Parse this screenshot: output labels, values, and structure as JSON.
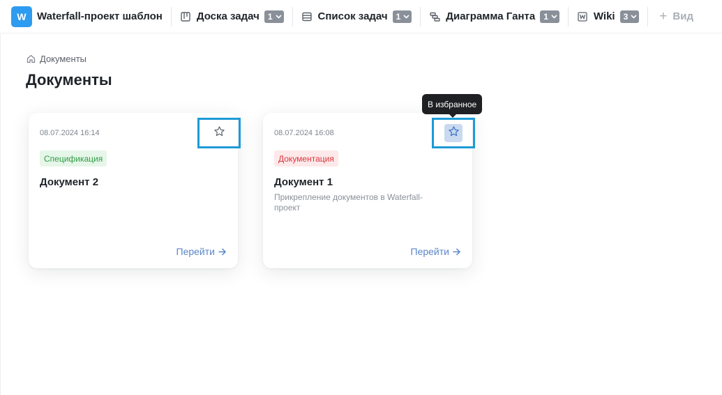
{
  "header": {
    "logo_letter": "W",
    "project_title": "Waterfall-проект шаблон",
    "tabs": [
      {
        "label": "Доска задач",
        "count": "1",
        "icon": "board-icon"
      },
      {
        "label": "Список задач",
        "count": "1",
        "icon": "list-icon"
      },
      {
        "label": "Диаграмма Ганта",
        "count": "1",
        "icon": "gantt-icon"
      },
      {
        "label": "Wiki",
        "count": "3",
        "icon": "wiki-icon"
      }
    ],
    "add_view_label": "Вид",
    "add_view_icon": "plus-icon"
  },
  "breadcrumb": {
    "home_icon": "home-icon",
    "label": "Документы"
  },
  "page": {
    "title": "Документы"
  },
  "documents": [
    {
      "date": "08.07.2024 16:14",
      "tag": "Спецификация",
      "tag_color": "#2f9c45",
      "name": "Документ 2",
      "description": "",
      "go_label": "Перейти",
      "favorite_icon": "star-icon"
    },
    {
      "date": "08.07.2024 16:08",
      "tag": "Документация",
      "tag_color": "#d9363e",
      "name": "Документ 1",
      "description": "Прикрепление документов в Waterfall-проект",
      "go_label": "Перейти",
      "favorite_icon": "star-icon"
    }
  ],
  "tooltip": {
    "text": "В избранное"
  },
  "colors": {
    "accent": "#2d9cf0",
    "link": "#5a86c7",
    "highlight_border": "#1d9ad6"
  }
}
